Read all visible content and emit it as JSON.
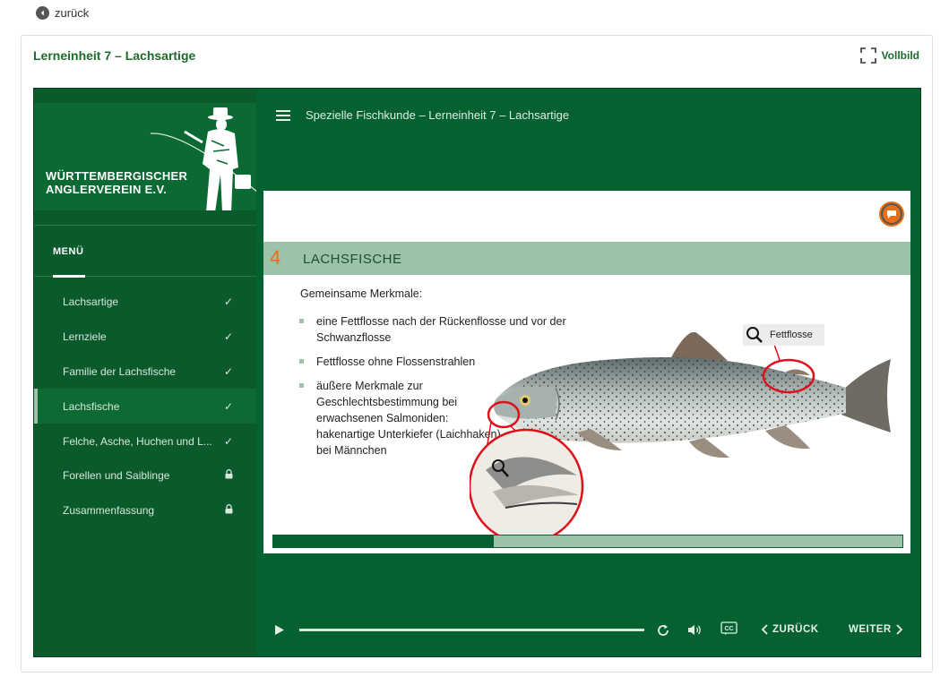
{
  "back": {
    "label": "zurück",
    "icon": "arrow-left-circle-icon"
  },
  "card": {
    "title": "Lerneinheit 7 – Lachsartige",
    "fullscreen_label": "Vollbild"
  },
  "logo": {
    "line1": "WÜRTTEMBERGISCHER",
    "line2": "ANGLERVEREIN E.V."
  },
  "menu": {
    "heading": "MENÜ",
    "items": [
      {
        "label": "Lachsartige",
        "status": "✓",
        "active": false
      },
      {
        "label": "Lernziele",
        "status": "✓",
        "active": false
      },
      {
        "label": "Familie der Lachsfische",
        "status": "✓",
        "active": false
      },
      {
        "label": "Lachsfische",
        "status": "✓",
        "active": true
      },
      {
        "label": "Felche, Asche, Huchen und L...",
        "status": "✓",
        "active": false
      },
      {
        "label": "Forellen und Saiblinge",
        "status": "lock",
        "active": false
      },
      {
        "label": "Zusammenfassung",
        "status": "lock",
        "active": false
      }
    ]
  },
  "topbar": {
    "course_title": "Spezielle Fischkunde – Lerneinheit 7 – Lachsartige"
  },
  "slide": {
    "number": "4",
    "heading": "LACHSFISCHE",
    "intro": "Gemeinsame Merkmale:",
    "bullets": [
      "eine Fettflosse nach der Rückenflosse und vor der Schwanzflosse",
      "Fettflosse ohne Flossenstrahlen",
      "äußere Merkmale zur Geschlechtsbestimmung bei erwachsenen Salmoniden: hakenartige Unterkiefer (Laichhaken) bei Männchen"
    ],
    "fettflosse_label": "Fettflosse",
    "progress_fraction": 0.35
  },
  "controls": {
    "seek_fraction": 0.0,
    "back_label": "ZURÜCK",
    "next_label": "WEITER"
  },
  "colors": {
    "primary_green": "#066130",
    "band_green": "#9cc3aa",
    "accent_orange": "#e57019",
    "highlight_red": "#e0101a"
  }
}
